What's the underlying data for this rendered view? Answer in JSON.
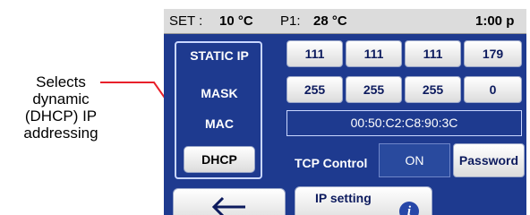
{
  "callout": {
    "lines": [
      "Selects",
      "dynamic",
      "(DHCP) IP",
      "addressing"
    ]
  },
  "status": {
    "set_label": "SET :",
    "set_value": "10 °C",
    "p1_label": "P1:",
    "p1_value": "28 °C",
    "time": "1:00 p"
  },
  "labels": {
    "static_ip": "STATIC IP",
    "mask": "MASK",
    "mac": "MAC"
  },
  "ip": [
    "111",
    "111",
    "111",
    "179"
  ],
  "mask": [
    "255",
    "255",
    "255",
    "0"
  ],
  "mac": "00:50:C2:C8:90:3C",
  "dhcp_button": "DHCP",
  "tcp": {
    "label": "TCP Control",
    "state": "ON"
  },
  "password_button": "Password",
  "nav": {
    "back_icon": "back-arrow-icon",
    "ip_setting": "IP setting",
    "info_icon": "info-icon",
    "info_glyph": "i"
  },
  "colors": {
    "panel": "#1e3a8f",
    "callout_line": "#e8202a"
  }
}
